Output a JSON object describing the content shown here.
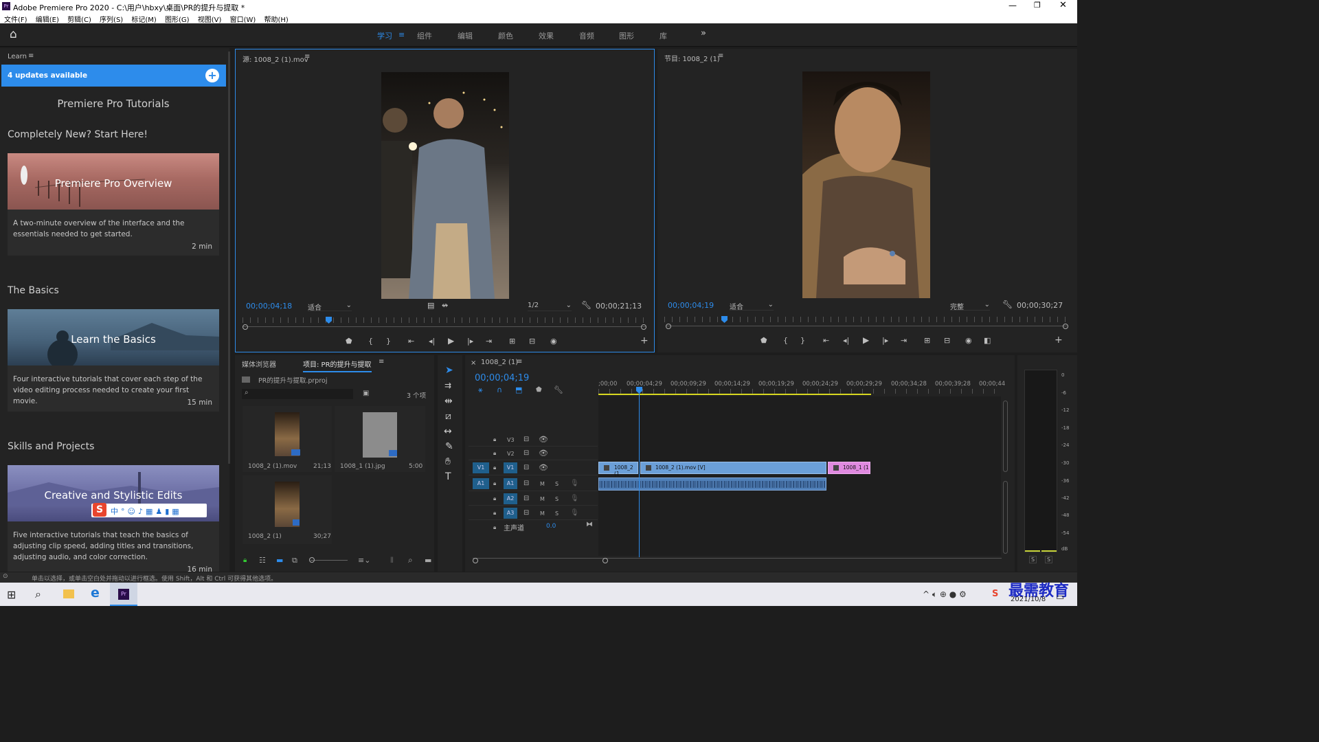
{
  "window": {
    "title": "Adobe Premiere Pro 2020 - C:\\用户\\hbxy\\桌面\\PR的提升与提取 *",
    "app_icon": "Pr"
  },
  "menu": [
    "文件(F)",
    "编辑(E)",
    "剪辑(C)",
    "序列(S)",
    "标记(M)",
    "图形(G)",
    "视图(V)",
    "窗口(W)",
    "帮助(H)"
  ],
  "workspaces": [
    "学习",
    "组件",
    "编辑",
    "颜色",
    "效果",
    "音频",
    "图形",
    "库"
  ],
  "learn": {
    "panel_title": "Learn",
    "updates": "4 updates available",
    "heading": "Premiere Pro Tutorials",
    "sections": [
      {
        "title": "Completely New? Start Here!",
        "card": {
          "label": "Premiere Pro Overview",
          "desc": "A two-minute overview of the interface and the essentials needed to get started.",
          "duration": "2 min"
        }
      },
      {
        "title": "The Basics",
        "card": {
          "label": "Learn the Basics",
          "desc": "Four interactive tutorials that cover each step of the video editing process needed to create your first movie.",
          "duration": "15 min"
        }
      },
      {
        "title": "Skills and Projects",
        "card": {
          "label": "Creative and Stylistic Edits",
          "desc": "Five interactive tutorials that teach the basics of adjusting clip speed, adding titles and transitions, adjusting audio, and color correction.",
          "duration": "16 min"
        }
      }
    ]
  },
  "source": {
    "title": "源: 1008_2 (1).mov",
    "timecode": "00;00;04;18",
    "fit": "适合",
    "resolution": "1/2",
    "duration": "00;00;21;13"
  },
  "program": {
    "title": "节目: 1008_2 (1)",
    "timecode": "00;00;04;19",
    "fit": "适合",
    "quality": "完整",
    "duration": "00;00;30;27"
  },
  "project": {
    "tab_media": "媒体浏览器",
    "tab_project": "项目: PR的提升与提取",
    "file": "PR的提升与提取.prproj",
    "count": "3 个项",
    "items": [
      {
        "name": "1008_2 (1).mov",
        "duration": "21;13"
      },
      {
        "name": "1008_1 (1).jpg",
        "duration": "5:00"
      },
      {
        "name": "1008_2 (1)",
        "duration": "30;27"
      }
    ]
  },
  "timeline": {
    "tab": "1008_2 (1)",
    "timecode": "00;00;04;19",
    "ruler": [
      ";00;00",
      "00;00;04;29",
      "00;00;09;29",
      "00;00;14;29",
      "00;00;19;29",
      "00;00;24;29",
      "00;00;29;29",
      "00;00;34;28",
      "00;00;39;28",
      "00;00;44"
    ],
    "video_tracks": [
      "V3",
      "V2",
      "V1"
    ],
    "audio_tracks": [
      "A1",
      "A2",
      "A3"
    ],
    "master": "主声道",
    "master_val": "0.0",
    "src_v": "V1",
    "src_a": "A1",
    "clips": {
      "v1_a": "1008_2 (1",
      "v1_b": "1008_2 (1).mov [V]",
      "v1_c": "1008_1 (1"
    }
  },
  "meter": {
    "scale": [
      "0",
      "-6",
      "-12",
      "-18",
      "-24",
      "-30",
      "-36",
      "-42",
      "-48",
      "-54",
      "dB"
    ],
    "solo": [
      "S",
      "S"
    ]
  },
  "status": "单击以选择，或单击空白处并拖动以进行框选。使用 Shift，Alt 和 Ctrl 可获得其他选项。",
  "taskbar": {
    "date": "2021/10/8",
    "watermark": "最需教育"
  },
  "colors": {
    "accent": "#2d8ceb",
    "clip_video": "#6b9fd8",
    "clip_image": "#e08ae0",
    "updates_bar": "#2d8ceb"
  }
}
